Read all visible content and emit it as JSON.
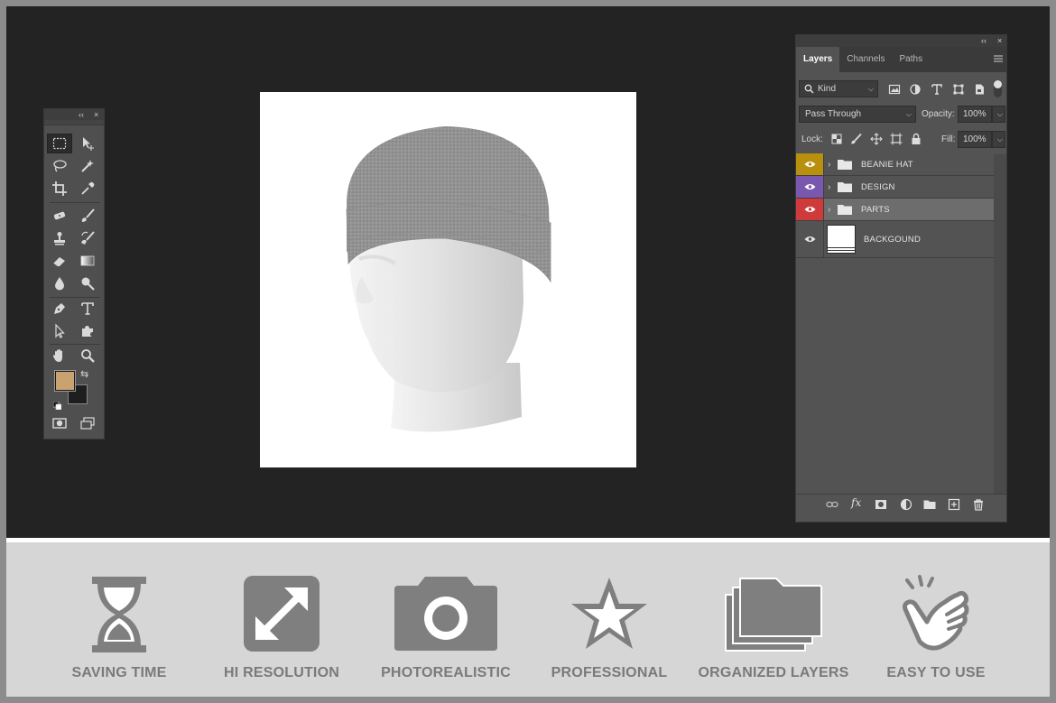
{
  "colors": {
    "workspace": "#232323",
    "panel": "#535353",
    "foreground_swatch": "#c8a26f",
    "background_swatch": "#1e1e1e",
    "label_beanie_hat": "#b8900e",
    "label_design": "#7a58b0",
    "label_parts": "#cf3b3b",
    "feature_icon": "#7f7f7f"
  },
  "tools_panel": {
    "collapse_glyph": "‹‹",
    "close_glyph": "×"
  },
  "layers_panel": {
    "collapse_glyph": "‹‹",
    "close_glyph": "×",
    "tabs": [
      {
        "label": "Layers",
        "active": true
      },
      {
        "label": "Channels",
        "active": false
      },
      {
        "label": "Paths",
        "active": false
      }
    ],
    "filter_kind": "Kind",
    "blend_mode": "Pass Through",
    "opacity_label": "Opacity:",
    "opacity_value": "100%",
    "lock_label": "Lock:",
    "fill_label": "Fill:",
    "fill_value": "100%",
    "layers": [
      {
        "name": "BEANIE HAT",
        "type": "group",
        "label_color": "#b8900e",
        "selected": false
      },
      {
        "name": "DESIGN",
        "type": "group",
        "label_color": "#7a58b0",
        "selected": false
      },
      {
        "name": "PARTS",
        "type": "group",
        "label_color": "#cf3b3b",
        "selected": true
      },
      {
        "name": "BACKGOUND",
        "type": "layer",
        "label_color": "",
        "selected": false
      }
    ]
  },
  "features": [
    {
      "label": "SAVING TIME",
      "icon": "hourglass-icon"
    },
    {
      "label": "HI RESOLUTION",
      "icon": "expand-arrows-icon"
    },
    {
      "label": "PHOTOREALISTIC",
      "icon": "camera-icon"
    },
    {
      "label": "PROFESSIONAL",
      "icon": "star-icon"
    },
    {
      "label": "ORGANIZED LAYERS",
      "icon": "folders-icon"
    },
    {
      "label": "EASY TO USE",
      "icon": "pointing-hand-icon"
    }
  ]
}
